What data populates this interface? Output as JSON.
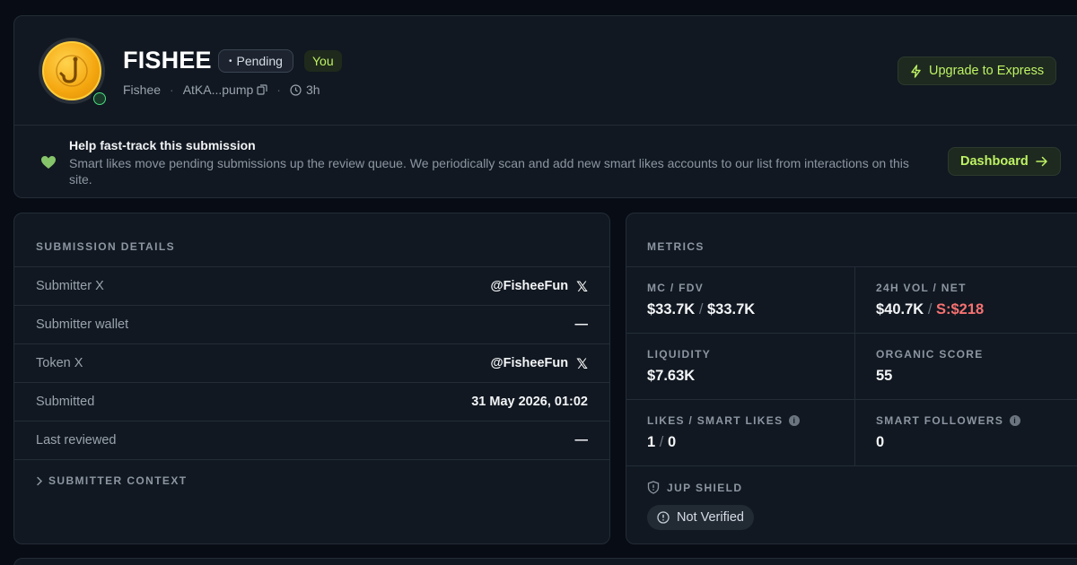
{
  "header": {
    "title": "FISHEE",
    "status_badge": "Pending",
    "you_badge": "You",
    "name": "Fishee",
    "address": "AtKA...pump",
    "age": "3h",
    "upgrade_label": "Upgrade to Express"
  },
  "help": {
    "title": "Help fast-track this submission",
    "text": "Smart likes move pending submissions up the review queue. We periodically scan and add new smart likes accounts to our list from interactions on this site.",
    "dashboard_label": "Dashboard"
  },
  "details": {
    "section_label": "SUBMISSION DETAILS",
    "rows": [
      {
        "label": "Submitter X",
        "value": "@FisheeFun"
      },
      {
        "label": "Submitter wallet",
        "value": "—"
      },
      {
        "label": "Token X",
        "value": "@FisheeFun"
      },
      {
        "label": "Submitted",
        "value": "31 May 2026, 01:02"
      },
      {
        "label": "Last reviewed",
        "value": "—"
      }
    ],
    "context_label": "SUBMITTER CONTEXT"
  },
  "metrics": {
    "section_label": "METRICS",
    "mc_fdv": {
      "label": "MC / FDV",
      "mc": "$33.7K",
      "fdv": "$33.7K"
    },
    "vol_net": {
      "label": "24H VOL / NET",
      "vol": "$40.7K",
      "net": "S:$218"
    },
    "liquidity": {
      "label": "LIQUIDITY",
      "value": "$7.63K"
    },
    "organic": {
      "label": "ORGANIC SCORE",
      "value": "55"
    },
    "likes": {
      "label": "LIKES / SMART LIKES",
      "likes": "1",
      "smart": "0"
    },
    "smart_followers": {
      "label": "SMART FOLLOWERS",
      "value": "0"
    },
    "shield": {
      "label": "JUP SHIELD",
      "status": "Not Verified"
    }
  },
  "colors": {
    "accent_green": "#bef264",
    "negative_red": "#f87171",
    "background": "#080c14",
    "card": "#111821"
  },
  "icons": [
    "fish-hook-coin-icon",
    "status-dot-icon",
    "copy-icon",
    "clock-icon",
    "lightning-icon",
    "heart-icon",
    "arrow-right-icon",
    "x-logo-icon",
    "chevron-right-icon",
    "info-icon",
    "shield-icon",
    "alert-circle-icon"
  ]
}
